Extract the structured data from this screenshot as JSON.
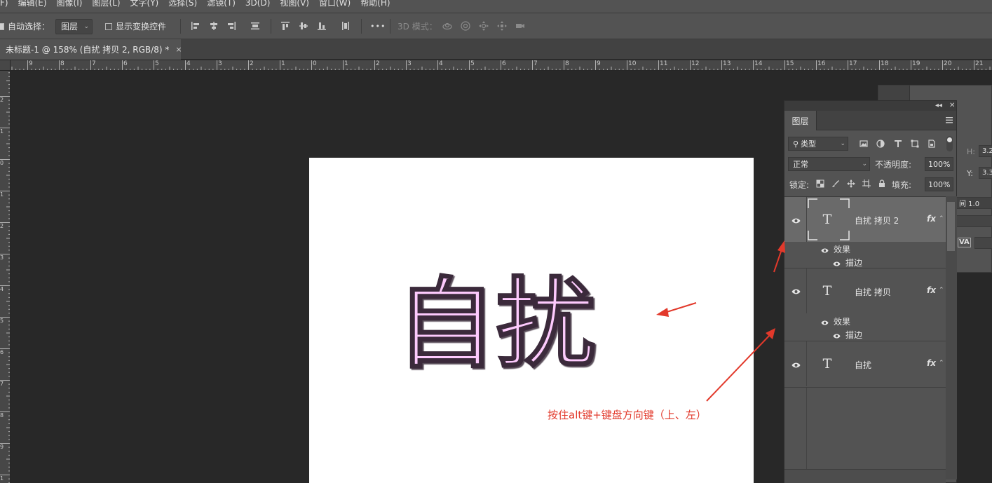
{
  "menubar": {
    "items": [
      "F)",
      "编辑(E)",
      "图像(I)",
      "图层(L)",
      "文字(Y)",
      "选择(S)",
      "滤镜(T)",
      "3D(D)",
      "视图(V)",
      "窗口(W)",
      "帮助(H)"
    ]
  },
  "options": {
    "auto_select_label": "自动选择：",
    "auto_select_value": "图层",
    "auto_select_checked": true,
    "show_transform_label": "显示变换控件",
    "show_transform_checked": false,
    "more_label": "•••",
    "mode_3d_label": "3D 模式："
  },
  "document_tab": {
    "title": "未标题-1 @ 158% (自扰 拷贝 2, RGB/8) *",
    "close": "×"
  },
  "rulers": {
    "horizontal_labels": [
      "9",
      "8",
      "7",
      "6",
      "5",
      "4",
      "3",
      "2",
      "1",
      "0",
      "1",
      "2",
      "3",
      "4",
      "5",
      "6",
      "7",
      "8",
      "9",
      "10",
      "11",
      "12",
      "13",
      "14",
      "15",
      "16",
      "17",
      "18",
      "19",
      "20",
      "21"
    ],
    "vertical_labels": [
      "2",
      "1",
      "0",
      "1",
      "2",
      "3",
      "4",
      "5",
      "6",
      "7",
      "8",
      "9",
      "1"
    ]
  },
  "canvas": {
    "artwork_text": "自扰",
    "fill_color": "#fdcafd",
    "stroke_color": "#3a2a3a",
    "annotation_text": "按住alt键+键盘方向键（上、左）",
    "annotation_color": "#e2392b"
  },
  "properties_panel": {
    "h_label": "H:",
    "h_value": "3.2",
    "y_label": "Y:",
    "y_value": "3.3",
    "scale_value": "间 1.0",
    "va_label": "VA"
  },
  "layers_panel": {
    "collapse_label": "◂◂",
    "close_label": "✕",
    "tab_label": "图层",
    "filter_kind": "类型",
    "blend_mode": "正常",
    "opacity_label": "不透明度:",
    "opacity_value": "100%",
    "lock_label": "锁定:",
    "fill_label": "填充:",
    "fill_value": "100%",
    "layers": [
      {
        "name": "自扰 拷贝 2",
        "thumb": "T",
        "fx": "fx",
        "selected": true,
        "effects_label": "效果",
        "stroke_label": "描边"
      },
      {
        "name": "自扰 拷贝",
        "thumb": "T",
        "fx": "fx",
        "selected": false,
        "effects_label": "效果",
        "stroke_label": "描边"
      },
      {
        "name": "自扰",
        "thumb": "T",
        "fx": "fx",
        "selected": false
      }
    ]
  }
}
